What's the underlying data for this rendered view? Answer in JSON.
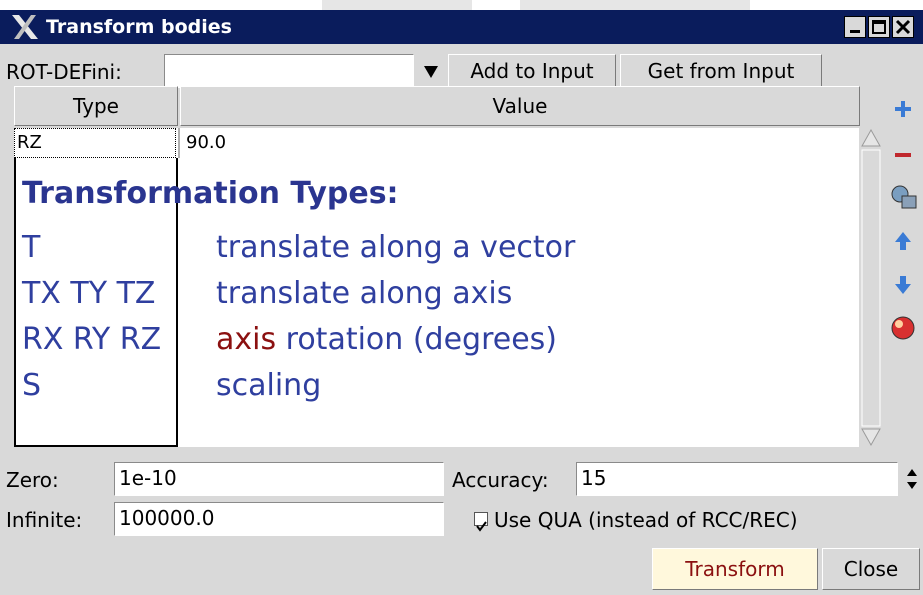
{
  "window": {
    "title": "Transform bodies"
  },
  "rotdefi": {
    "label": "ROT-DEFini:",
    "value": "",
    "add_button": "Add to Input",
    "get_button": "Get from Input"
  },
  "table": {
    "columns": [
      "Type",
      "Value"
    ],
    "rows": [
      {
        "type": "RZ",
        "value": "90.0"
      }
    ]
  },
  "help": {
    "heading": "Transformation Types:",
    "items": [
      {
        "code": "T",
        "desc": "translate along a vector"
      },
      {
        "code": "TX TY TZ",
        "desc": "translate along axis"
      },
      {
        "code": "RX RY RZ",
        "desc_highlight": "axis",
        "desc": " rotation (degrees)"
      },
      {
        "code": "S",
        "desc": "scaling"
      }
    ]
  },
  "options": {
    "zero_label": "Zero:",
    "zero_value": "1e-10",
    "accuracy_label": "Accuracy:",
    "accuracy_value": "15",
    "infinite_label": "Infinite:",
    "infinite_value": "100000.0",
    "use_qua_label": "Use QUA (instead of RCC/REC)",
    "use_qua_checked": true
  },
  "actions": {
    "transform": "Transform",
    "close": "Close"
  },
  "side_icons": [
    "add-icon",
    "remove-icon",
    "find-icon",
    "move-up-icon",
    "move-down-icon",
    "clear-icon"
  ],
  "colors": {
    "titlebar": "#0a1c5c",
    "help_text": "#2f3f9f",
    "highlight": "#8b1010",
    "transform_button_bg": "#fff8dc"
  }
}
